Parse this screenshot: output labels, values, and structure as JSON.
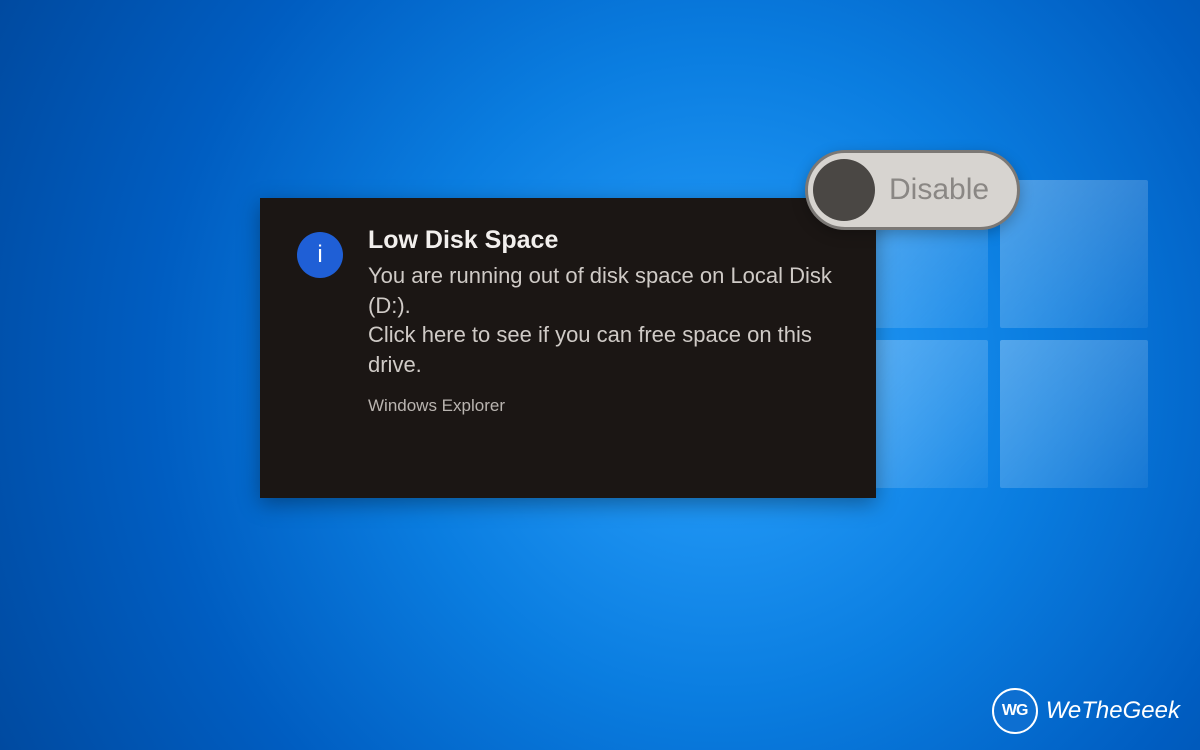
{
  "notification": {
    "icon_name": "info-icon",
    "icon_glyph": "i",
    "title": "Low Disk Space",
    "body_line1": "You are running out of disk space on Local Disk (D:).",
    "body_line2": "Click here to see if you can free space on this drive.",
    "source": "Windows Explorer"
  },
  "toggle": {
    "state": "off",
    "label": "Disable"
  },
  "watermark": {
    "badge_text": "WG",
    "brand_text": "WeTheGeek"
  },
  "colors": {
    "desktop_primary": "#0a7de0",
    "toast_bg": "#1b1614",
    "info_circle": "#1f5fd6",
    "toggle_bg": "#d7d4d0",
    "toggle_knob": "#4a4744"
  }
}
